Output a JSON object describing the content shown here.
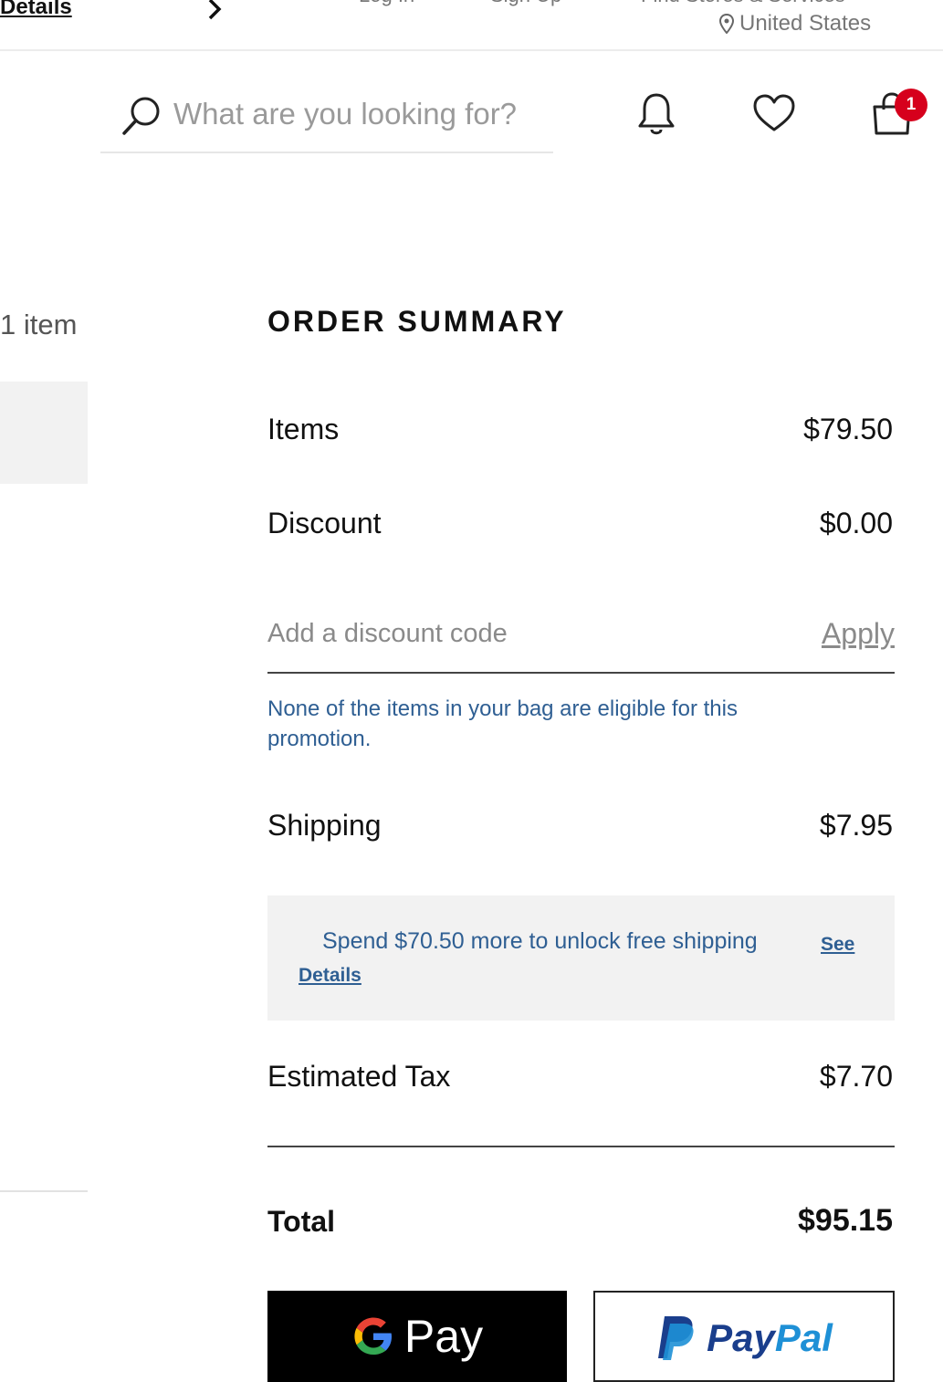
{
  "topbar": {
    "details_label": "Details",
    "login_label": "Log In",
    "signup_label": "Sign Up",
    "stores_label": "Find Stores & Services",
    "location_label": "United States"
  },
  "header": {
    "search_placeholder": "What are you looking for?",
    "cart_count": "1"
  },
  "bag": {
    "item_count_label": "1 item"
  },
  "summary": {
    "title": "ORDER SUMMARY",
    "items_label": "Items",
    "items_value": "$79.50",
    "discount_label": "Discount",
    "discount_value": "$0.00",
    "discount_placeholder": "Add a discount code",
    "apply_label": "Apply",
    "promo_message": "None of the items in your bag are eligible for this promotion.",
    "shipping_label": "Shipping",
    "shipping_value": "$7.95",
    "free_shipping_message": "Spend $70.50 more to unlock free shipping",
    "see_label": "See",
    "details_label": "Details",
    "tax_label": "Estimated Tax",
    "tax_value": "$7.70",
    "total_label": "Total",
    "total_value": "$95.15"
  },
  "payments": {
    "gpay_label": "Pay",
    "paypal_label_1": "Pay",
    "paypal_label_2": "Pal"
  },
  "colors": {
    "badge": "#d6001c",
    "link_blue": "#2f5f93",
    "paypal_dark": "#1a3e8c",
    "paypal_light": "#1e90d6"
  }
}
